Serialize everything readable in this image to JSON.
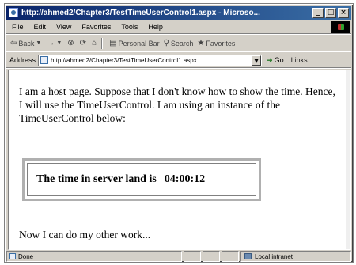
{
  "window": {
    "title": "http://ahmed2/Chapter3/TestTimeUserControl1.aspx - Microso..."
  },
  "menu": {
    "items": [
      "File",
      "Edit",
      "View",
      "Favorites",
      "Tools",
      "Help"
    ]
  },
  "toolbar": {
    "back_label": "Back",
    "forward_glyph": "→",
    "personal_bar_label": "Personal Bar",
    "search_label": "Search",
    "favorites_label": "Favorites"
  },
  "address": {
    "label": "Address",
    "url": "http://ahmed2/Chapter3/TestTimeUserControl1.aspx",
    "go_label": "Go",
    "links_label": "Links"
  },
  "page": {
    "intro_text": "I am a host page. Suppose that I don't know how to show the time. Hence, I will use the TimeUserControl. I am using an instance of the TimeUserControl below:",
    "time_label": "The time in server land is",
    "time_value": "04:00:12",
    "after_text": "Now I can do my other work..."
  },
  "status": {
    "text": "Done",
    "zone": "Local intranet"
  }
}
